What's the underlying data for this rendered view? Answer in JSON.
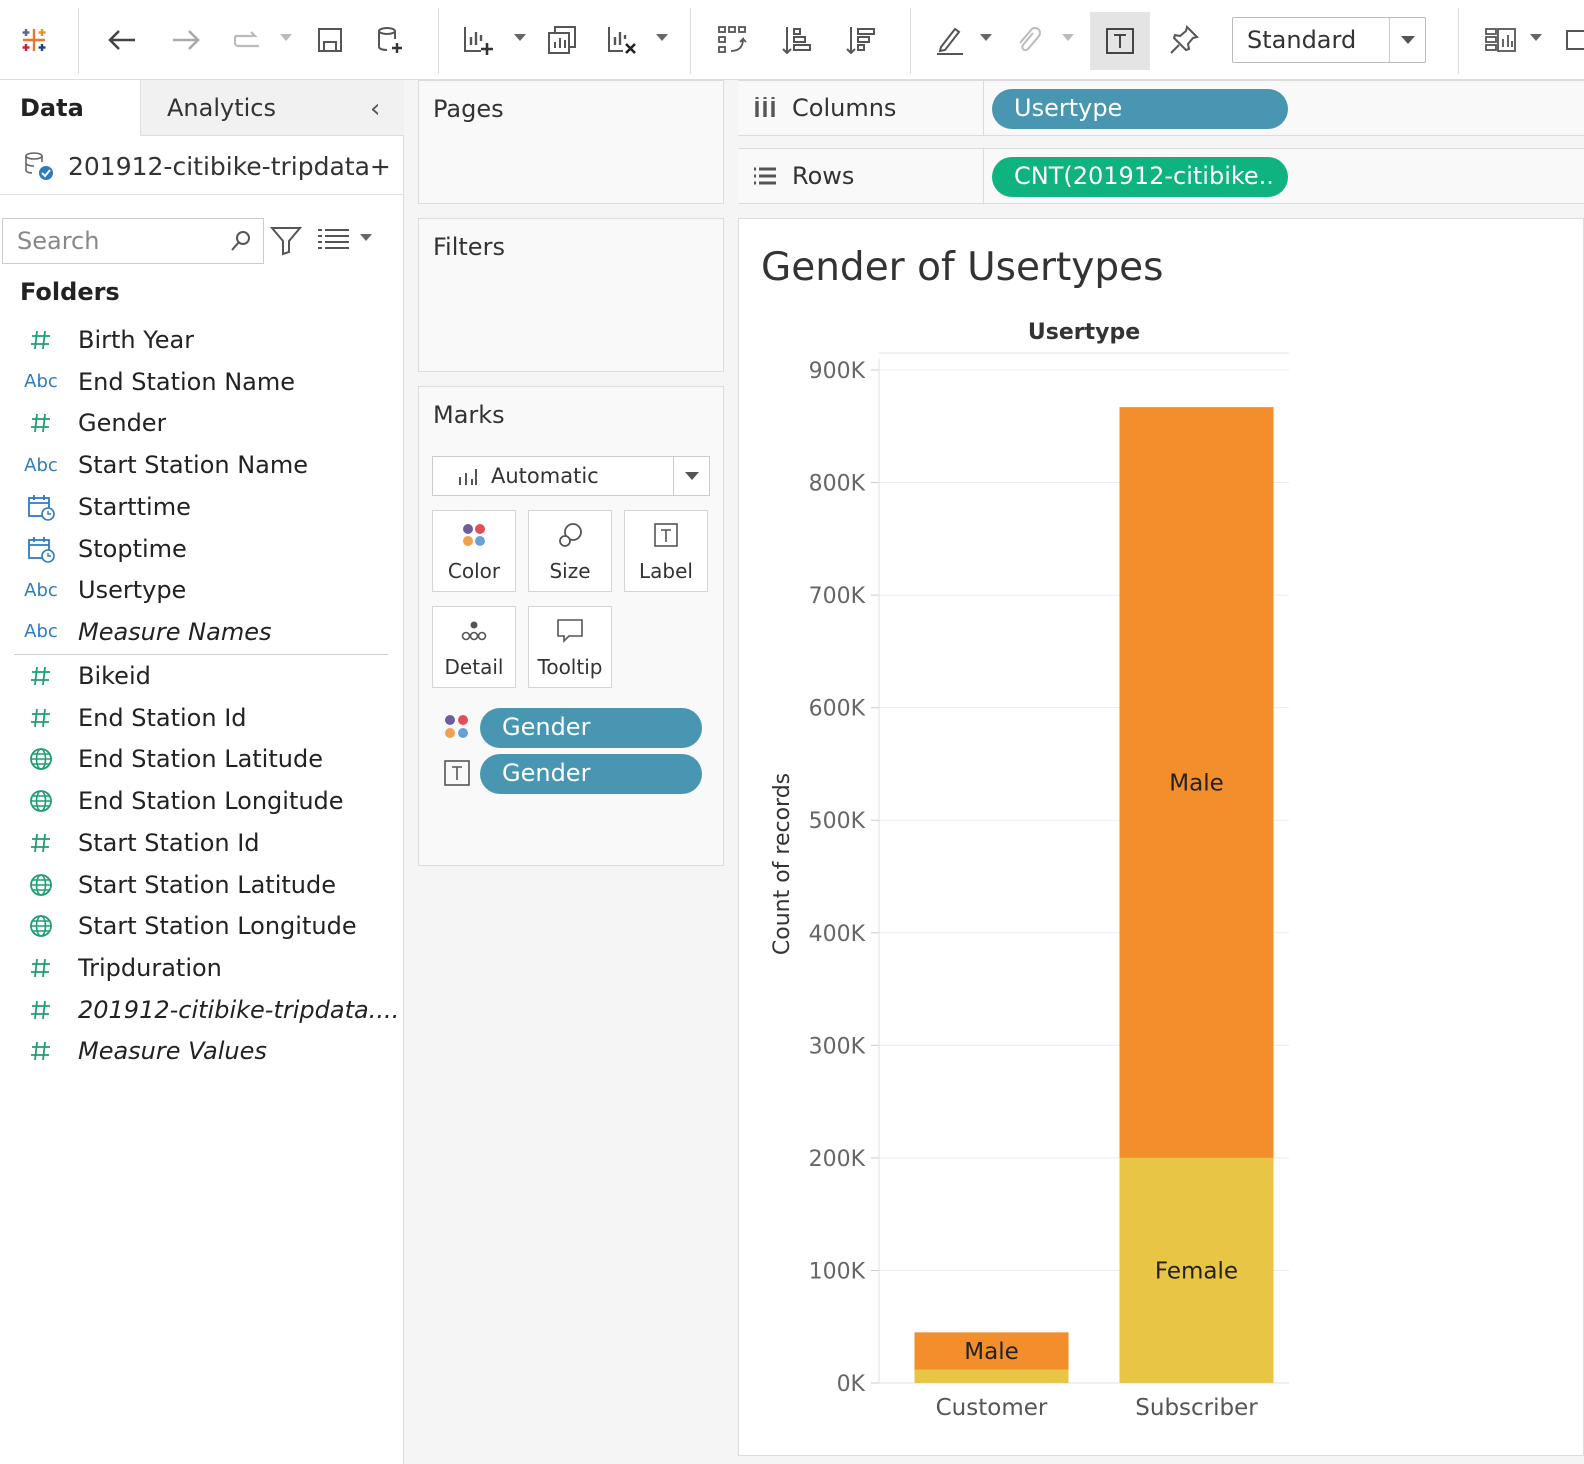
{
  "toolbar": {
    "standard_label": "Standard"
  },
  "data_pane": {
    "tab_data": "Data",
    "tab_analytics": "Analytics",
    "source_name": "201912-citibike-tripdata+",
    "search_placeholder": "Search",
    "folders_label": "Folders",
    "dimensions": [
      {
        "icon": "#",
        "label": "Birth Year"
      },
      {
        "icon": "Abc",
        "label": "End Station Name"
      },
      {
        "icon": "#",
        "label": "Gender"
      },
      {
        "icon": "Abc",
        "label": "Start Station Name"
      },
      {
        "icon": "date",
        "label": "Starttime"
      },
      {
        "icon": "date",
        "label": "Stoptime"
      },
      {
        "icon": "Abc",
        "label": "Usertype"
      },
      {
        "icon": "Abc",
        "label": "Measure Names"
      }
    ],
    "measures": [
      {
        "icon": "#",
        "label": "Bikeid"
      },
      {
        "icon": "#",
        "label": "End Station Id"
      },
      {
        "icon": "globe",
        "label": "End Station Latitude"
      },
      {
        "icon": "globe",
        "label": "End Station Longitude"
      },
      {
        "icon": "#",
        "label": "Start Station Id"
      },
      {
        "icon": "globe",
        "label": "Start Station Latitude"
      },
      {
        "icon": "globe",
        "label": "Start Station Longitude"
      },
      {
        "icon": "#",
        "label": "Tripduration"
      },
      {
        "icon": "#",
        "label": "201912-citibike-tripdata...."
      },
      {
        "icon": "#",
        "label": "Measure Values"
      }
    ]
  },
  "shelves": {
    "pages_label": "Pages",
    "filters_label": "Filters",
    "marks_label": "Marks",
    "mark_type": "Automatic",
    "mark_buttons": [
      "Color",
      "Size",
      "Label",
      "Detail",
      "Tooltip"
    ],
    "marks_pills": [
      "Gender",
      "Gender"
    ],
    "columns_label": "Columns",
    "columns_pill": "Usertype",
    "rows_label": "Rows",
    "rows_pill": "CNT(201912-citibike.."
  },
  "view": {
    "title": "Gender of Usertypes"
  },
  "chart_data": {
    "type": "bar",
    "stacked": true,
    "header": "Usertype",
    "ylabel": "Count of records",
    "ylim": [
      0,
      900000
    ],
    "yticks": [
      0,
      100000,
      200000,
      300000,
      400000,
      500000,
      600000,
      700000,
      800000,
      900000
    ],
    "ytick_labels": [
      "0K",
      "100K",
      "200K",
      "300K",
      "400K",
      "500K",
      "600K",
      "700K",
      "800K",
      "900K"
    ],
    "categories": [
      "Customer",
      "Subscriber"
    ],
    "series": [
      {
        "name": "Female",
        "color": "#e8c545",
        "values": [
          12000,
          200000
        ],
        "labels": [
          "",
          "Female"
        ]
      },
      {
        "name": "Male",
        "color": "#f28e2b",
        "values": [
          33000,
          667000
        ],
        "labels": [
          "Male",
          "Male"
        ]
      }
    ]
  }
}
